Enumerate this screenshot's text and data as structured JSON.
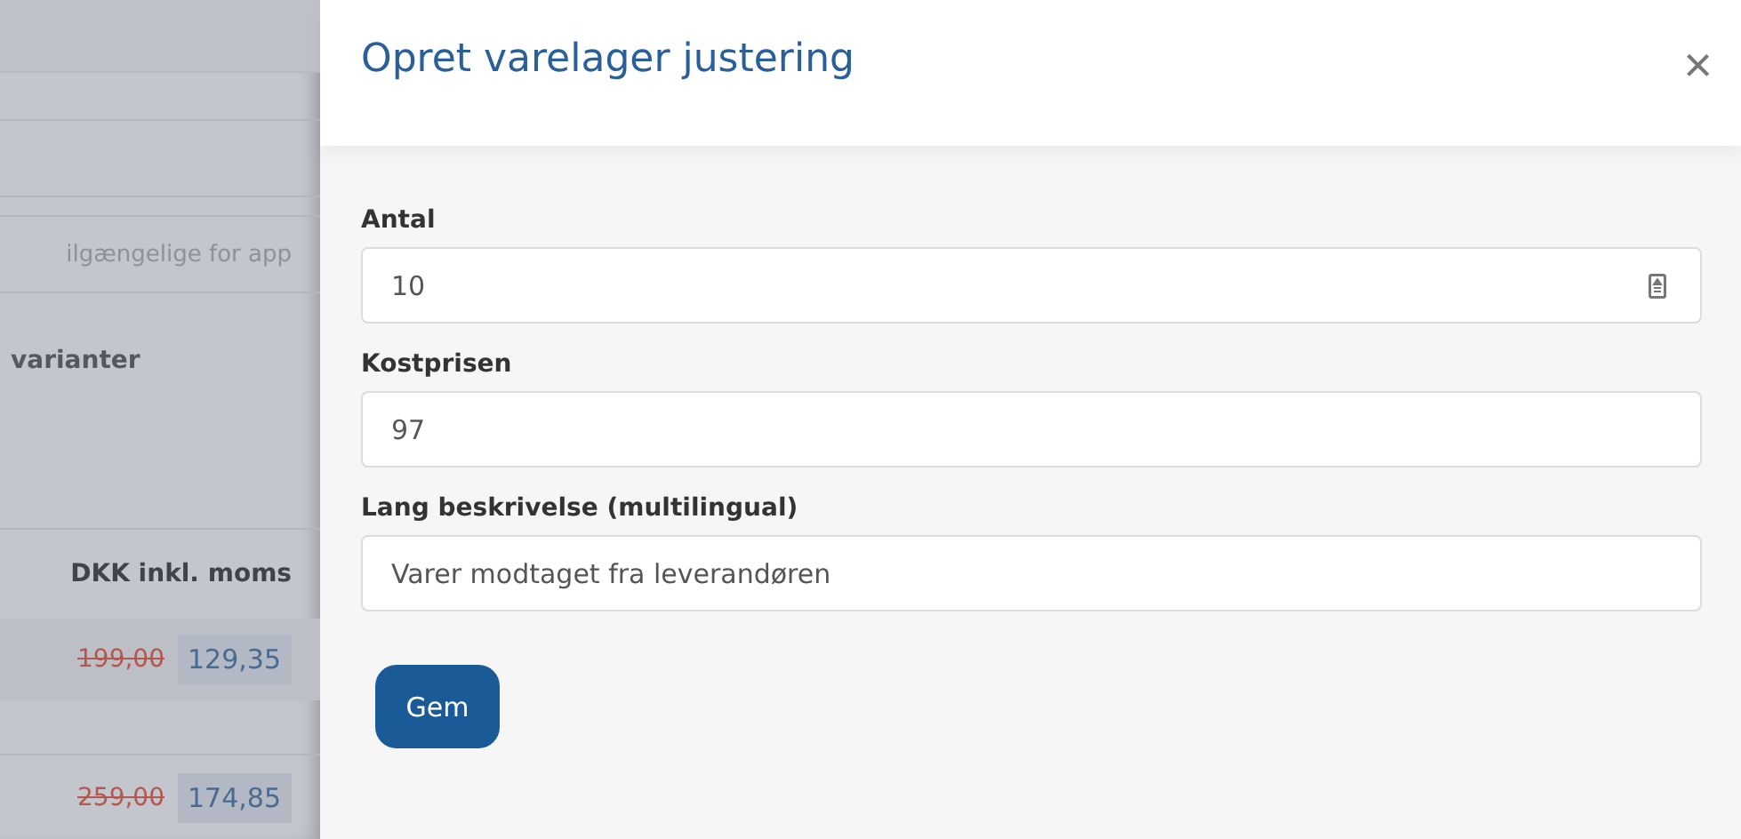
{
  "background": {
    "texts": [
      {
        "kind": "hint",
        "text": "ilgængelige for app"
      },
      {
        "kind": "label",
        "text": "varianter"
      }
    ],
    "price_header": "DKK inkl. moms",
    "rows": [
      {
        "old_price": "199,00",
        "price": "129,35"
      },
      {
        "old_price": "259,00",
        "price": "174,85"
      }
    ]
  },
  "dialog": {
    "title": "Opret varelager justering",
    "close": "×",
    "fields": [
      {
        "label": "Antal",
        "value": "10",
        "kind": "number"
      },
      {
        "label": "Kostprisen",
        "value": "97",
        "kind": "text"
      },
      {
        "label": "Lang beskrivelse (multilingual)",
        "value": "Varer modtaget fra leverandøren",
        "kind": "text"
      }
    ],
    "button": "Gem"
  }
}
